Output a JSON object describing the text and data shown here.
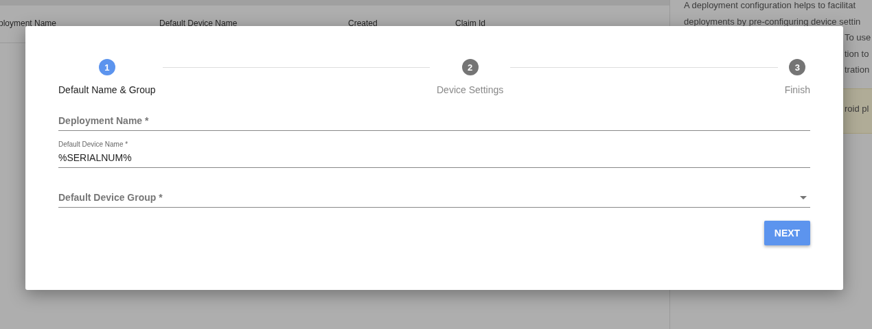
{
  "background": {
    "table_columns": [
      "ployment Name",
      "Default Device Name",
      "Created",
      "Claim Id"
    ],
    "info_lines": [
      "A deployment configuration helps to facilitat",
      "deployments by pre-configuring device settin"
    ],
    "info_fragments": [
      "To use",
      "tion to",
      "tration"
    ],
    "notice": "roid pl"
  },
  "dialog": {
    "steps": [
      {
        "number": "1",
        "label": "Default Name & Group",
        "selected": true
      },
      {
        "number": "2",
        "label": "Device Settings",
        "selected": false
      },
      {
        "number": "3",
        "label": "Finish",
        "selected": false
      }
    ],
    "fields": [
      {
        "kind": "text",
        "placeholder": "Deployment Name *"
      },
      {
        "kind": "text",
        "label": "Default Device Name *",
        "value": "%SERIALNUM%"
      },
      {
        "kind": "select",
        "placeholder": "Default Device Group *"
      }
    ],
    "button": "NEXT"
  }
}
